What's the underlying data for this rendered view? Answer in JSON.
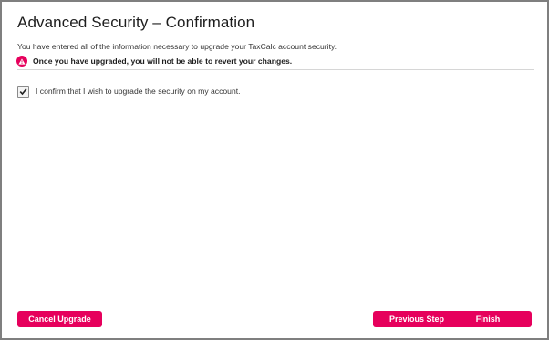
{
  "page": {
    "title": "Advanced Security – Confirmation",
    "intro": "You have entered all of the information necessary to upgrade your TaxCalc account security.",
    "warning": {
      "icon": "warning-triangle-icon",
      "text": "Once you have upgraded, you will not be able to revert your changes."
    },
    "confirm": {
      "label": "I confirm that I wish to upgrade the security on my account.",
      "checked": true
    }
  },
  "actions": {
    "cancel_label": "Cancel Upgrade",
    "previous_label": "Previous Step",
    "finish_label": "Finish"
  },
  "colors": {
    "accent": "#e6005c",
    "text": "#1d1d1d",
    "divider": "#d6d6d6",
    "frame_border": "#7f7f7f"
  }
}
